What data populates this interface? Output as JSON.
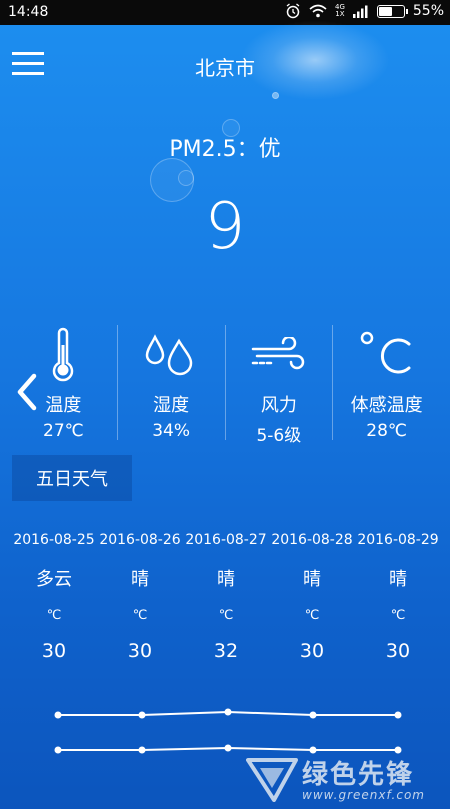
{
  "status_bar": {
    "time": "14:48",
    "network": "4G",
    "network_sub": "1X",
    "battery_percent": "55%",
    "battery_level": 0.55
  },
  "header": {
    "city": "北京市",
    "menu_icon": "hamburger-menu-icon"
  },
  "air_quality": {
    "pm_label": "PM2.5：优",
    "value": "9"
  },
  "current": [
    {
      "icon": "thermometer-icon",
      "label": "温度",
      "value": "27℃"
    },
    {
      "icon": "humidity-drops-icon",
      "label": "湿度",
      "value": "34%"
    },
    {
      "icon": "wind-icon",
      "label": "风力",
      "value": "5-6级"
    },
    {
      "icon": "celsius-icon",
      "label": "体感温度",
      "value": "28℃"
    }
  ],
  "forecast": {
    "tab_label": "五日天气",
    "days": [
      {
        "date": "2016-08-25",
        "condition": "多云",
        "unit": "℃",
        "temp": "30",
        "high": 30,
        "low": 30
      },
      {
        "date": "2016-08-26",
        "condition": "晴",
        "unit": "℃",
        "temp": "30",
        "high": 30,
        "low": 30
      },
      {
        "date": "2016-08-27",
        "condition": "晴",
        "unit": "℃",
        "temp": "32",
        "high": 32,
        "low": 32
      },
      {
        "date": "2016-08-28",
        "condition": "晴",
        "unit": "℃",
        "temp": "30",
        "high": 30,
        "low": 30
      },
      {
        "date": "2016-08-29",
        "condition": "晴",
        "unit": "℃",
        "temp": "30",
        "high": 30,
        "low": 30
      }
    ]
  },
  "watermark": {
    "text": "绿色先锋",
    "url": "www.greenxf.com"
  }
}
